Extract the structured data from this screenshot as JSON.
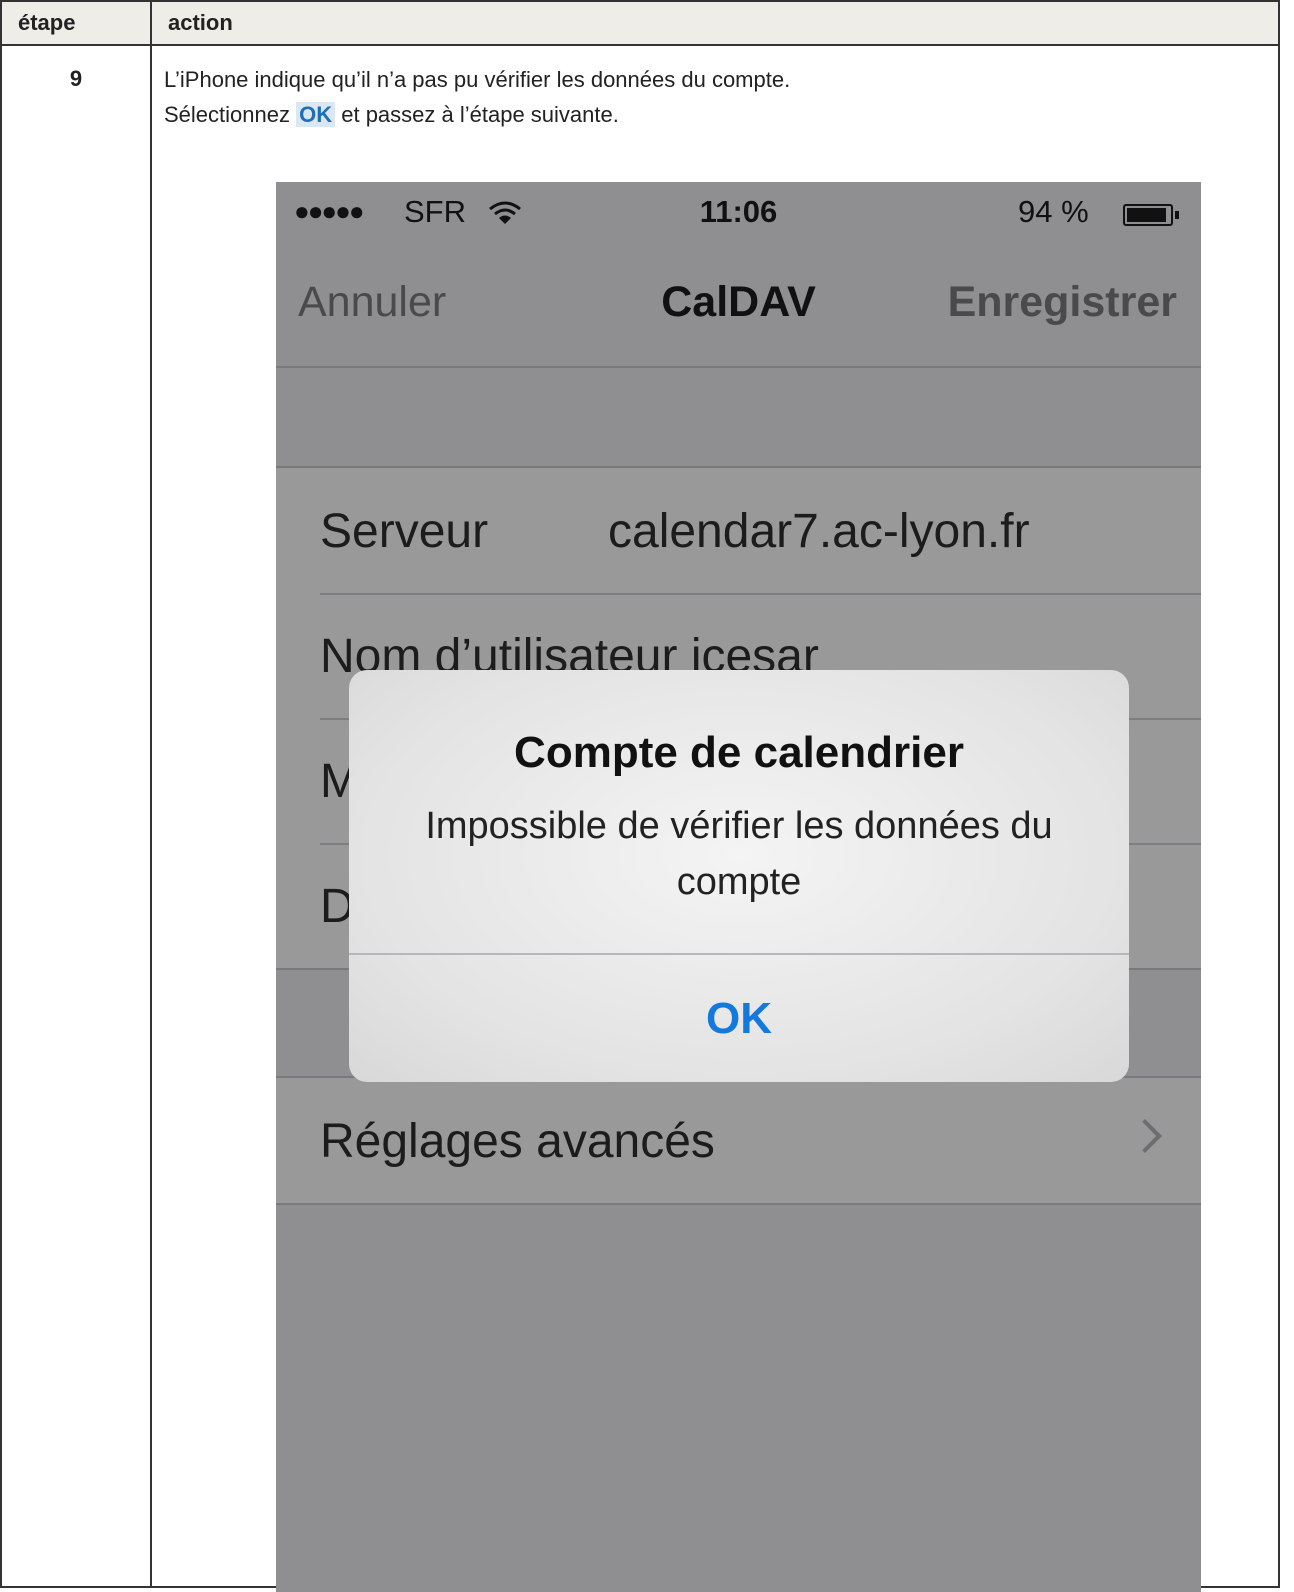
{
  "table": {
    "header_step": "étape",
    "header_action": "action",
    "step_number": "9",
    "instruction_line1": "L’iPhone indique qu’il n’a pas pu vérifier les données du compte.",
    "instruction_line2_prefix": "Sélectionnez",
    "instruction_line2_highlight": "OK",
    "instruction_line2_suffix": "et passez à l’étape suivante."
  },
  "phone": {
    "status_bar": {
      "signal": "●●●●●",
      "carrier": "SFR",
      "wifi_icon": "wifi-icon",
      "time": "11:06",
      "battery_percent": "94 %",
      "battery_level": 0.94
    },
    "nav_bar": {
      "cancel_label": "Annuler",
      "title": "CalDAV",
      "save_label": "Enregistrer"
    },
    "fields": [
      {
        "label": "Serveur",
        "value": "calendar7.ac-lyon.fr"
      },
      {
        "label": "Nom d’utilisateur",
        "value": "icesar"
      },
      {
        "label": "M",
        "value": ""
      },
      {
        "label": "D",
        "value": ""
      }
    ],
    "advanced": {
      "label": "Réglages avancés",
      "chevron_icon": "chevron-right-icon"
    },
    "alert": {
      "title": "Compte de calendrier",
      "message": "Impossible de vérifier les données du compte",
      "ok_label": "OK"
    }
  },
  "colors": {
    "link_blue": "#1479dc",
    "highlight_bg": "#dbe8f4",
    "header_bg": "#eeede8",
    "dim_background": "#8f8f91"
  }
}
